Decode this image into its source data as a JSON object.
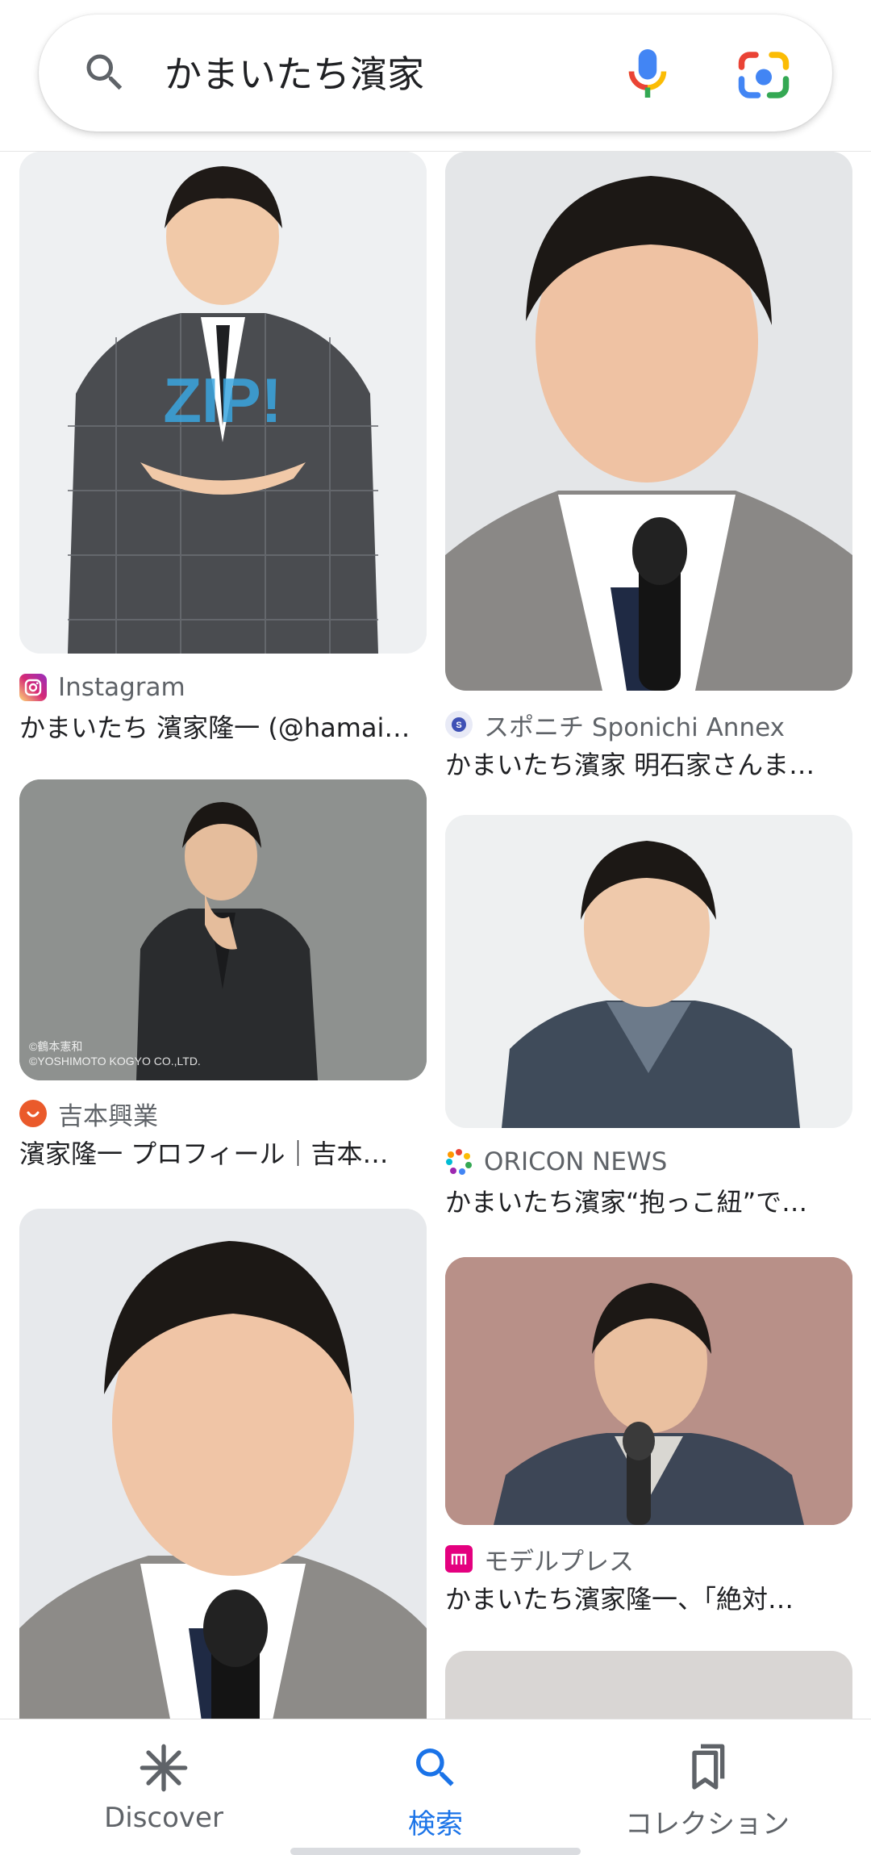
{
  "search": {
    "query": "かまいたち濱家",
    "icons": [
      "search-icon",
      "mic-icon",
      "google-lens-icon"
    ]
  },
  "results": {
    "left": [
      {
        "source": "Instagram",
        "favicon": "instagram-icon",
        "title": "かまいたち 濱家隆一 (@hamai…",
        "bg": "#eef0f2"
      },
      {
        "source": "吉本興業",
        "favicon": "yoshimoto-icon",
        "title": "濱家隆一 プロフィール｜吉本…",
        "bg": "#8e918f",
        "watermark": [
          "©鶴本憲和",
          "©YOSHIMOTO KOGYO CO.,LTD."
        ]
      },
      {
        "source": "",
        "title": "",
        "bg": "#e7e9ec"
      }
    ],
    "right": [
      {
        "source": "スポニチ Sponichi Annex",
        "favicon": "sponichi-icon",
        "title": "かまいたち濱家 明石家さんま…",
        "bg": "#e4e6e8"
      },
      {
        "source": "ORICON NEWS",
        "favicon": "oricon-icon",
        "title": "かまいたち濱家“抱っこ紐”で…",
        "bg": "#eef0f1"
      },
      {
        "source": "モデルプレス",
        "favicon": "modelpress-icon",
        "title": "かまいたち濱家隆一、「絶対…",
        "bg": "#b89088"
      },
      {
        "source": "",
        "title": "",
        "bg": "#d9d6d4"
      }
    ]
  },
  "nav": {
    "items": [
      {
        "label": "Discover",
        "icon": "discover-asterisk-icon",
        "active": false
      },
      {
        "label": "検索",
        "icon": "search-icon",
        "active": true
      },
      {
        "label": "コレクション",
        "icon": "collections-bookmark-icon",
        "active": false
      }
    ]
  },
  "colors": {
    "accent": "#1a73e8",
    "text_secondary": "#5f6368"
  }
}
